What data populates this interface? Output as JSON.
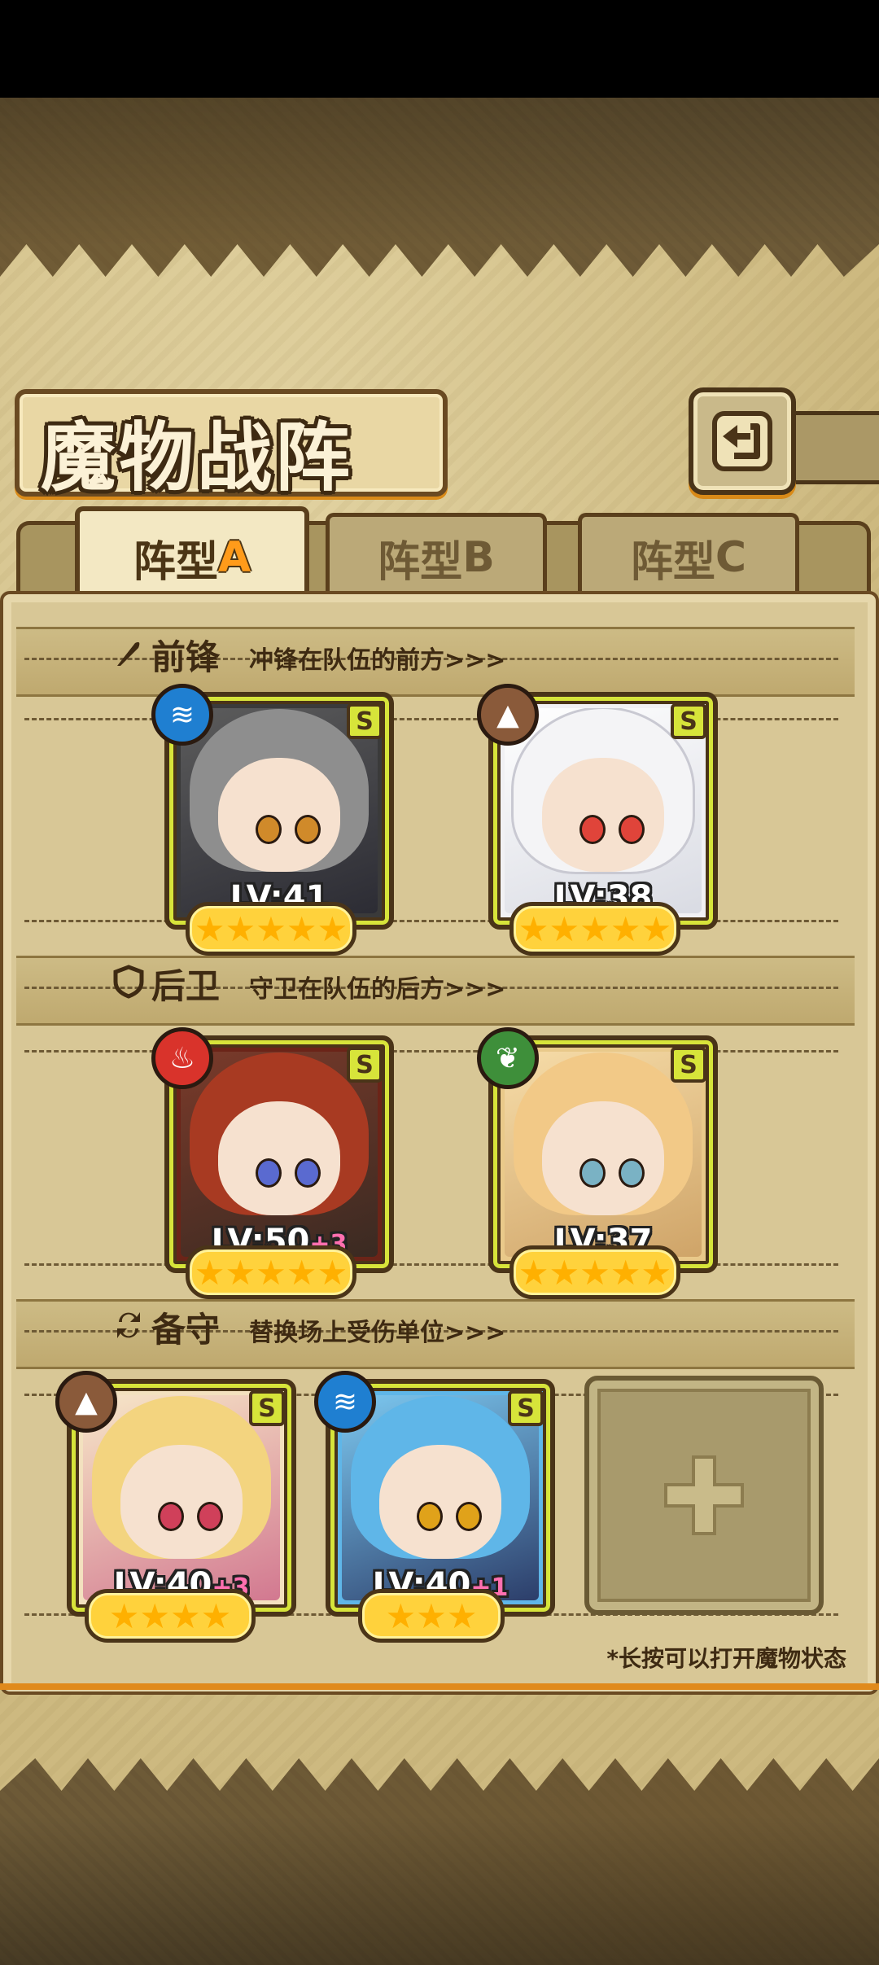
{
  "header": {
    "title": "魔物战阵"
  },
  "tabs": [
    {
      "prefix": "阵型",
      "letter": "A",
      "active": true
    },
    {
      "prefix": "阵型",
      "letter": "B",
      "active": false
    },
    {
      "prefix": "阵型",
      "letter": "C",
      "active": false
    }
  ],
  "sections": {
    "vanguard": {
      "title": "前锋",
      "subtitle": "冲锋在队伍的前方>>>",
      "icon": "feather-icon"
    },
    "rearguard": {
      "title": "后卫",
      "subtitle": "守卫在队伍的后方>>>",
      "icon": "shield-icon"
    },
    "reserve": {
      "title": "备守",
      "subtitle": "替换场上受伤单位>>>",
      "icon": "swap-icon"
    }
  },
  "units": {
    "v1": {
      "level": "LV:41",
      "plus": "",
      "rank": "S",
      "element": "water-icon",
      "stars": "★★★★★",
      "hair": "#8e8e8e"
    },
    "v2": {
      "level": "LV:38",
      "plus": "",
      "rank": "S",
      "element": "earth-icon",
      "stars": "★★★★★",
      "hair": "#f4f4f6"
    },
    "r1": {
      "level": "LV:50",
      "plus": "+3",
      "rank": "S",
      "element": "fire-icon",
      "stars": "★★★★★",
      "hair": "#a83a22"
    },
    "r2": {
      "level": "LV:37",
      "plus": "",
      "rank": "S",
      "element": "leaf-icon",
      "stars": "★★★★★",
      "hair": "#f2c987"
    },
    "b1": {
      "level": "LV:40",
      "plus": "+3",
      "rank": "S",
      "element": "earth-icon",
      "stars": "★★★★",
      "hair": "#f3d47f"
    },
    "b2": {
      "level": "LV:40",
      "plus": "+1",
      "rank": "S",
      "element": "water-icon",
      "stars": "★★★",
      "hair": "#5fb6e8"
    }
  },
  "empty_slot": {
    "symbol": "+"
  },
  "footer": {
    "hint": "*长按可以打开魔物状态"
  },
  "colors": {
    "water": "#1f7fd1",
    "earth": "#8a5a3a",
    "fire": "#d9332b",
    "leaf": "#3e8f3a",
    "rank": "#d7e43a",
    "accent": "#e08a1c"
  }
}
